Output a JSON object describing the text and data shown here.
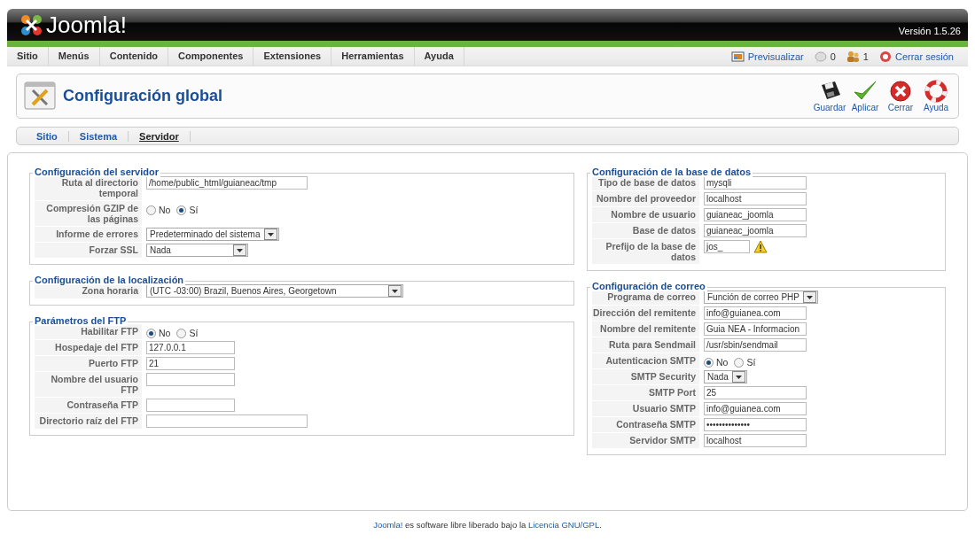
{
  "header": {
    "logo": "Joomla!",
    "version": "Versión 1.5.26"
  },
  "menu": [
    {
      "label": "Sitio"
    },
    {
      "label": "Menús"
    },
    {
      "label": "Contenido"
    },
    {
      "label": "Componentes"
    },
    {
      "label": "Extensiones"
    },
    {
      "label": "Herramientas"
    },
    {
      "label": "Ayuda"
    }
  ],
  "status": [
    {
      "kind": "preview",
      "label": "Previsualizar"
    },
    {
      "kind": "messages",
      "label": "0"
    },
    {
      "kind": "users",
      "label": "1"
    },
    {
      "kind": "logout",
      "label": "Cerrar sesión"
    }
  ],
  "toolbar": {
    "title": "Configuración global",
    "buttons": [
      {
        "kind": "save",
        "label": "Guardar"
      },
      {
        "kind": "apply",
        "label": "Aplicar"
      },
      {
        "kind": "cancel",
        "label": "Cerrar"
      },
      {
        "kind": "help",
        "label": "Ayuda"
      }
    ]
  },
  "subtabs": [
    {
      "label": "Sitio",
      "selected": false
    },
    {
      "label": "Sistema",
      "selected": false
    },
    {
      "label": "Servidor",
      "selected": true
    }
  ],
  "left_column": [
    {
      "legend": "Configuración del servidor",
      "rows": [
        {
          "label": "Ruta al directorio temporal",
          "kind": "text",
          "value": "/home/public_html/guianeac/tmp"
        },
        {
          "label": "Compresión GZIP de las páginas",
          "kind": "radio",
          "options": [
            {
              "label": "No",
              "selected": false
            },
            {
              "label": "Sí",
              "selected": true
            }
          ]
        },
        {
          "label": "Informe de errores",
          "kind": "select",
          "value": "Predeterminado del sistema"
        },
        {
          "label": "Forzar SSL",
          "kind": "select",
          "value": "Nada"
        }
      ]
    },
    {
      "legend": "Configuración de la localización",
      "rows": [
        {
          "label": "Zona horaria",
          "kind": "select",
          "value": "(UTC -03:00) Brazil, Buenos Aires, Georgetown"
        }
      ]
    },
    {
      "legend": "Parámetros del FTP",
      "rows": [
        {
          "label": "Habilitar FTP",
          "kind": "radio",
          "options": [
            {
              "label": "No",
              "selected": true
            },
            {
              "label": "Sí",
              "selected": false
            }
          ]
        },
        {
          "label": "Hospedaje del FTP",
          "kind": "text",
          "value": "127.0.0.1"
        },
        {
          "label": "Puerto FTP",
          "kind": "text",
          "value": "21"
        },
        {
          "label": "Nombre del usuario FTP",
          "kind": "text"
        },
        {
          "label": "Contraseña FTP",
          "kind": "text"
        },
        {
          "label": "Directorio raíz del FTP",
          "kind": "text"
        }
      ]
    }
  ],
  "right_column": [
    {
      "legend": "Configuración de la base de datos",
      "rows": [
        {
          "label": "Tipo de base de datos",
          "kind": "text",
          "value": "mysqli"
        },
        {
          "label": "Nombre del proveedor",
          "kind": "text",
          "value": "localhost"
        },
        {
          "label": "Nombre de usuario",
          "kind": "text",
          "value": "guianeac_joomla"
        },
        {
          "label": "Base de datos",
          "kind": "text",
          "value": "guianeac_joomla"
        },
        {
          "label": "Prefijo de la base de datos",
          "kind": "text",
          "value": "jos_",
          "warning": true
        }
      ]
    },
    {
      "legend": "Configuración de correo",
      "rows": [
        {
          "label": "Programa de correo",
          "kind": "select",
          "value": "Función de correo PHP"
        },
        {
          "label": "Dirección del remitente",
          "kind": "text",
          "value": "info@guianea.com"
        },
        {
          "label": "Nombre del remitente",
          "kind": "text",
          "value": "Guia NEA - Informacion"
        },
        {
          "label": "Ruta para Sendmail",
          "kind": "text",
          "value": "/usr/sbin/sendmail"
        },
        {
          "label": "Autenticacion SMTP",
          "kind": "radio",
          "options": [
            {
              "label": "No",
              "selected": true
            },
            {
              "label": "Sí",
              "selected": false
            }
          ]
        },
        {
          "label": "SMTP Security",
          "kind": "select",
          "value": "Nada"
        },
        {
          "label": "SMTP Port",
          "kind": "text",
          "value": "25"
        },
        {
          "label": "Usuario SMTP",
          "kind": "text",
          "value": "info@guianea.com"
        },
        {
          "label": "Contraseña SMTP",
          "kind": "password",
          "value": "••••••••••••••"
        },
        {
          "label": "Servidor SMTP",
          "kind": "text",
          "value": "localhost"
        }
      ]
    }
  ],
  "footer": {
    "link": "Joomla!",
    "text": "es software libre liberado bajo la",
    "license": "Licencia GNU/GPL",
    "end": "."
  }
}
